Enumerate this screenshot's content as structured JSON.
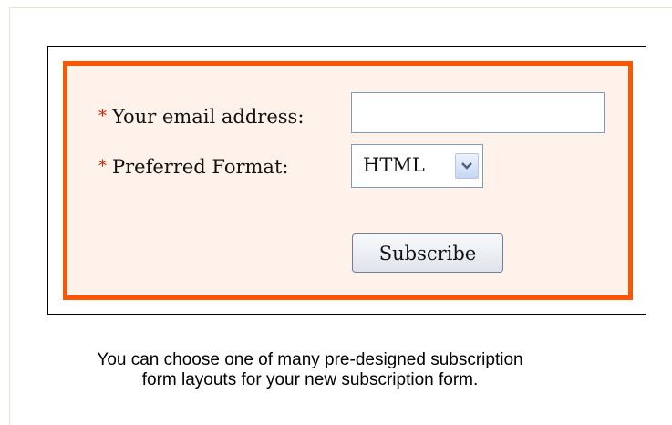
{
  "form": {
    "email_label": "Your email address:",
    "email_value": "",
    "format_label": "Preferred Format:",
    "format_selected": "HTML",
    "subscribe_label": "Subscribe",
    "required_marker": "*"
  },
  "caption": {
    "line1": "You can choose one of many pre-designed subscription",
    "line2": "form layouts for your new subscription form."
  },
  "colors": {
    "border_accent": "#ff5500",
    "form_background": "#fff2ea",
    "required_marker": "#cc2200"
  },
  "icons": {
    "select_arrow": "chevron-down-icon"
  }
}
